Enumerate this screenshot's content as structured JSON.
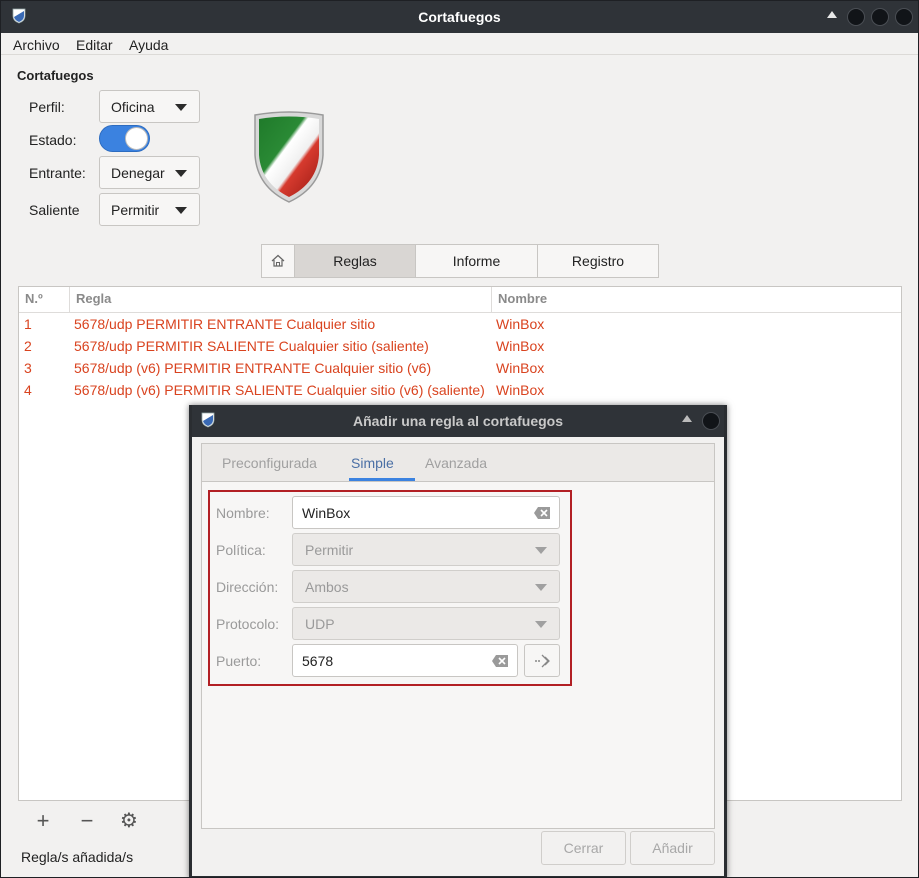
{
  "window": {
    "title": "Cortafuegos"
  },
  "menu": [
    "Archivo",
    "Editar",
    "Ayuda"
  ],
  "settings": {
    "section_title": "Cortafuegos",
    "profile_label": "Perfil:",
    "profile_value": "Oficina",
    "status_label": "Estado:",
    "status_on": true,
    "incoming_label": "Entrante:",
    "incoming_value": "Denegar",
    "outgoing_label": "Saliente",
    "outgoing_value": "Permitir"
  },
  "tabs": [
    {
      "label": "Reglas",
      "active": true
    },
    {
      "label": "Informe",
      "active": false
    },
    {
      "label": "Registro",
      "active": false
    }
  ],
  "rules_table": {
    "columns": [
      "N.º",
      "Regla",
      "Nombre"
    ],
    "rows": [
      {
        "num": "1",
        "rule": "5678/udp PERMITIR ENTRANTE Cualquier sitio",
        "name": "WinBox"
      },
      {
        "num": "2",
        "rule": "5678/udp PERMITIR SALIENTE Cualquier sitio (saliente)",
        "name": "WinBox"
      },
      {
        "num": "3",
        "rule": "5678/udp (v6) PERMITIR ENTRANTE Cualquier sitio (v6)",
        "name": "WinBox"
      },
      {
        "num": "4",
        "rule": "5678/udp (v6) PERMITIR SALIENTE Cualquier sitio (v6) (saliente)",
        "name": "WinBox"
      }
    ]
  },
  "toolbar": {
    "add_glyph": "+",
    "remove_glyph": "−",
    "settings_glyph": "⚙"
  },
  "status_text": "Regla/s añadida/s",
  "dialog": {
    "title": "Añadir una regla al cortafuegos",
    "tabs": [
      {
        "label": "Preconfigurada",
        "active": false
      },
      {
        "label": "Simple",
        "active": true
      },
      {
        "label": "Avanzada",
        "active": false
      }
    ],
    "fields": {
      "name_label": "Nombre:",
      "name_value": "WinBox",
      "policy_label": "Política:",
      "policy_value": "Permitir",
      "direction_label": "Dirección:",
      "direction_value": "Ambos",
      "protocol_label": "Protocolo:",
      "protocol_value": "UDP",
      "port_label": "Puerto:",
      "port_value": "5678"
    },
    "close_button": "Cerrar",
    "add_button": "Añadir"
  },
  "colors": {
    "accent": "#3b82e0",
    "rule_text": "#d9431f",
    "highlight_border": "#b21f24",
    "titlebar": "#2f3338"
  }
}
